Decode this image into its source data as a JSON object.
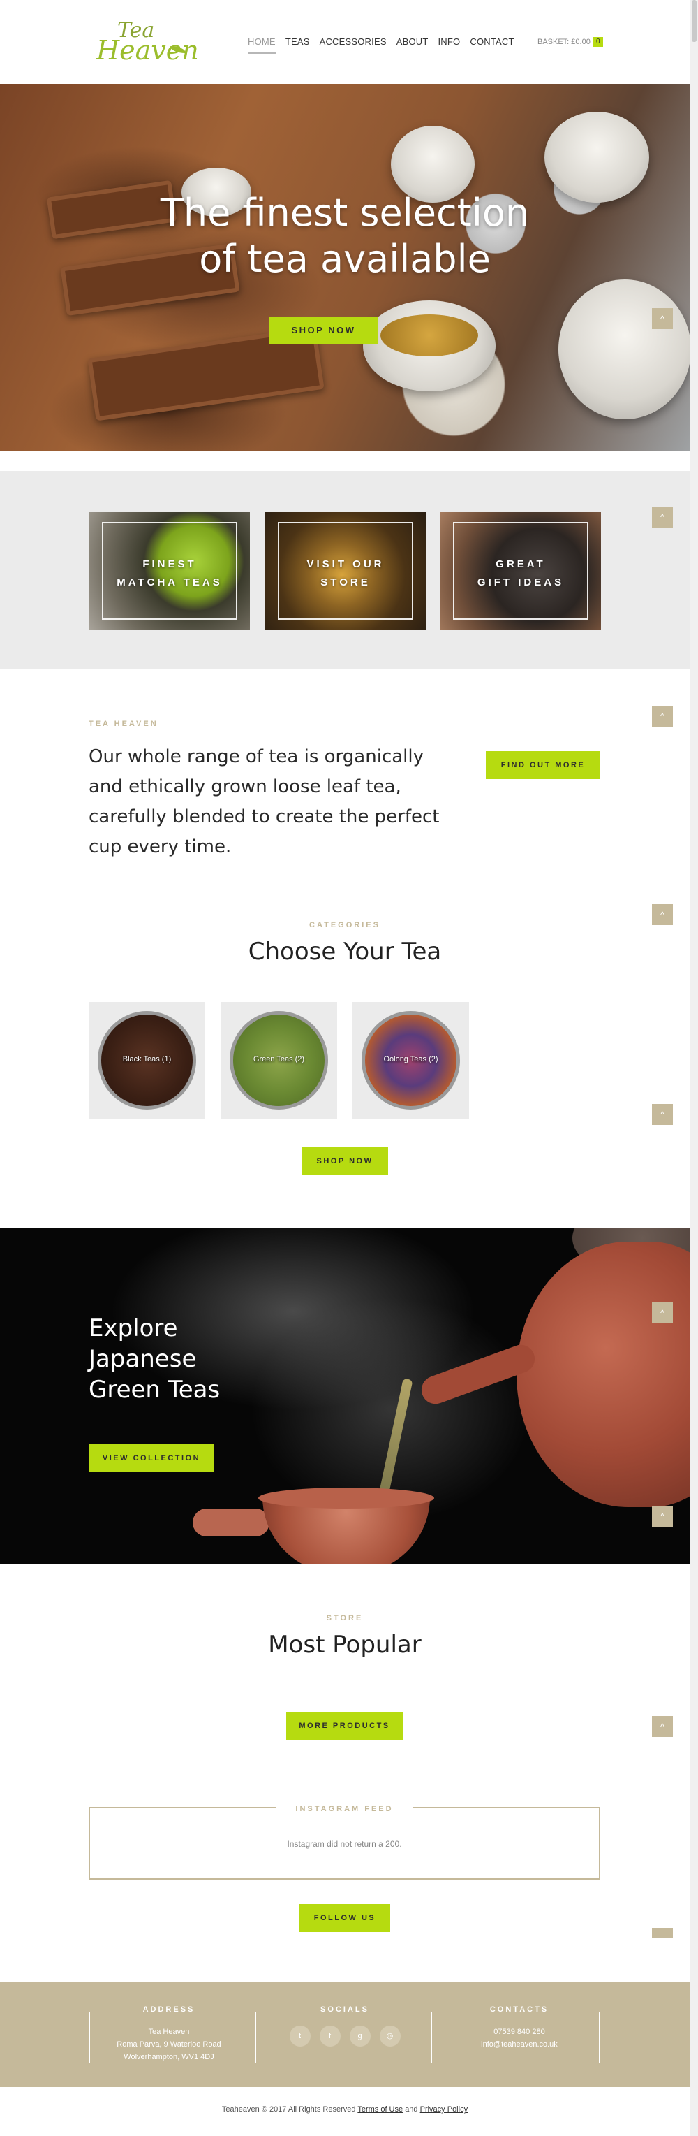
{
  "header": {
    "logo_line1": "Tea",
    "logo_line2": "Heaven",
    "nav": [
      "HOME",
      "TEAS",
      "ACCESSORIES",
      "ABOUT",
      "INFO",
      "CONTACT"
    ],
    "basket_label": "BASKET: £0.00",
    "basket_count": "0"
  },
  "hero": {
    "title_line1": "The finest selection",
    "title_line2": "of tea available",
    "button": "SHOP NOW"
  },
  "scroll_top_glyph": "^",
  "promo": {
    "tiles": [
      {
        "line1": "FINEST",
        "line2": "MATCHA TEAS"
      },
      {
        "line1": "VISIT OUR",
        "line2": "STORE"
      },
      {
        "line1": "GREAT",
        "line2": "GIFT IDEAS"
      }
    ]
  },
  "about": {
    "eyebrow": "TEA HEAVEN",
    "text": "Our whole range of tea is organically and ethically grown loose leaf tea, carefully blended to create the perfect cup every time.",
    "button": "FIND OUT MORE"
  },
  "categories": {
    "eyebrow": "CATEGORIES",
    "title": "Choose Your Tea",
    "items": [
      "Black Teas (1)",
      "Green Teas (2)",
      "Oolong Teas (2)"
    ],
    "button": "SHOP NOW"
  },
  "japanese": {
    "title_line1": "Explore",
    "title_line2": "Japanese",
    "title_line3": "Green Teas",
    "button": "VIEW COLLECTION"
  },
  "popular": {
    "eyebrow": "STORE",
    "title": "Most Popular",
    "button": "MORE PRODUCTS"
  },
  "instagram": {
    "legend": "INSTAGRAM FEED",
    "message": "Instagram did not return a 200.",
    "button": "FOLLOW US"
  },
  "footer": {
    "address_heading": "ADDRESS",
    "address_lines": [
      "Tea Heaven",
      "Roma Parva, 9 Waterloo Road",
      "Wolverhampton, WV1 4DJ"
    ],
    "socials_heading": "SOCIALS",
    "social_icons": [
      "t",
      "f",
      "g",
      "◎"
    ],
    "contacts_heading": "CONTACTS",
    "contact_lines": [
      "07539 840 280",
      "info@teaheaven.co.uk"
    ]
  },
  "copyright": {
    "text": "Teaheaven © 2017 All Rights Reserved",
    "terms": "Terms of Use",
    "and": "and",
    "privacy": "Privacy Policy"
  },
  "colors": {
    "accent_lime": "#b6db10",
    "accent_tan": "#c5b99a"
  }
}
